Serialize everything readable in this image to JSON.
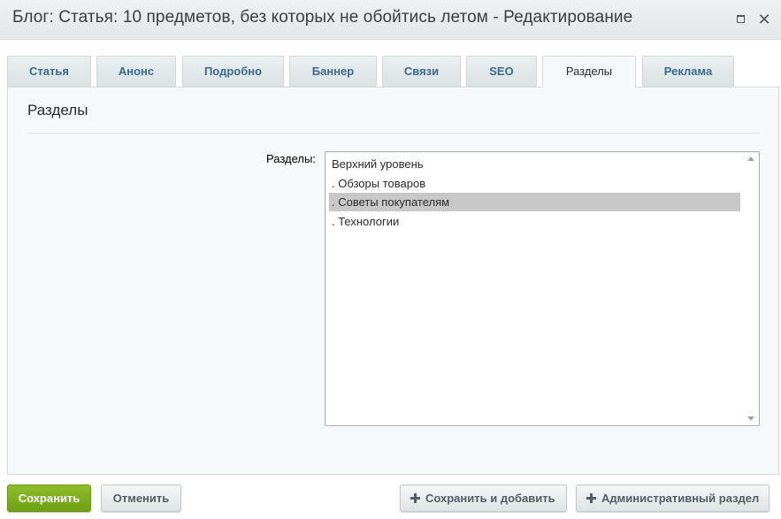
{
  "window": {
    "title": "Блог: Статья: 10 предметов, без которых не обойтись летом - Редактирование"
  },
  "tabs": [
    {
      "label": "Статья"
    },
    {
      "label": "Анонс"
    },
    {
      "label": "Подробно"
    },
    {
      "label": "Баннер"
    },
    {
      "label": "Связи"
    },
    {
      "label": "SEO"
    },
    {
      "label": "Разделы",
      "active": true
    },
    {
      "label": "Реклама"
    }
  ],
  "panel": {
    "title": "Разделы",
    "field_label": "Разделы:",
    "options": [
      {
        "label": "Верхний уровень"
      },
      {
        "label": ". Обзоры товаров"
      },
      {
        "label": ". Советы покупателям",
        "selected": true
      },
      {
        "label": ". Технологии"
      }
    ],
    "selected_color": "#c8c8c8"
  },
  "footer": {
    "save_label": "Сохранить",
    "cancel_label": "Отменить",
    "save_add_label": "Сохранить и добавить",
    "admin_label": "Административный раздел"
  },
  "colors": {
    "save_button": "#7aae1e",
    "tab_text": "#3b6a8c"
  },
  "icons": [
    "maximize-icon",
    "close-icon",
    "plus-icon"
  ]
}
